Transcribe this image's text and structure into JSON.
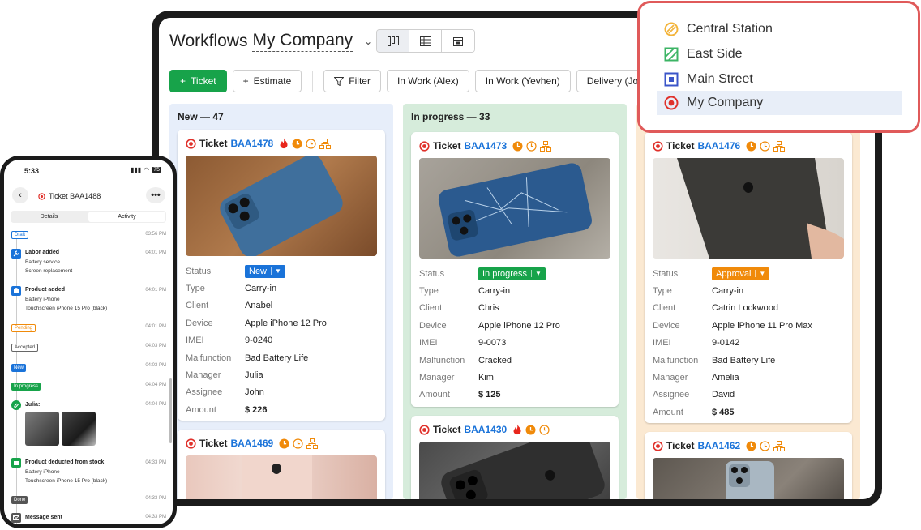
{
  "board": {
    "title": "Workflows",
    "company": "My Company",
    "toolbar": {
      "ticket_label": "Ticket",
      "estimate_label": "Estimate",
      "filter_label": "Filter",
      "filters": [
        "In Work (Alex)",
        "In Work (Yevhen)",
        "Delivery (John"
      ]
    },
    "field_labels": [
      "Status",
      "Type",
      "Client",
      "Device",
      "IMEI",
      "Malfunction",
      "Manager",
      "Assignee",
      "Amount"
    ],
    "columns": [
      {
        "header": "New — 47",
        "bg": "#e7eefa",
        "cards": [
          {
            "title": "Ticket",
            "id": "BAA1478",
            "status": "New",
            "status_color": "#1a73d9",
            "values": [
              "Carry-in",
              "Anabel",
              "Apple iPhone 12 Pro",
              "9-0240",
              "Bad Battery Life",
              "Julia",
              "John",
              "$ 226"
            ]
          },
          {
            "title": "Ticket",
            "id": "BAA1469"
          }
        ]
      },
      {
        "header": "In progress — 33",
        "bg": "#d6ecdb",
        "cards": [
          {
            "title": "Ticket",
            "id": "BAA1473",
            "status": "In progress",
            "status_color": "#17a34a",
            "values": [
              "Carry-in",
              "Chris",
              "Apple iPhone 12 Pro",
              "9-0073",
              "Cracked",
              "Kim",
              "$ 125"
            ]
          },
          {
            "title": "Ticket",
            "id": "BAA1430"
          }
        ]
      },
      {
        "header": "",
        "bg": "#fbe9d2",
        "cards": [
          {
            "title": "Ticket",
            "id": "BAA1476",
            "status": "Approval",
            "status_color": "#f08a0a",
            "values": [
              "Carry-in",
              "Catrin Lockwood",
              "Apple iPhone 11 Pro Max",
              "9-0142",
              "Bad Battery Life",
              "Amelia",
              "David",
              "$ 485"
            ]
          },
          {
            "title": "Ticket",
            "id": "BAA1462"
          }
        ]
      }
    ]
  },
  "locations": [
    {
      "name": "Central Station",
      "color": "#f3b43b",
      "icon": "hatched-circle-icon"
    },
    {
      "name": "East Side",
      "color": "#3cb465",
      "icon": "hatched-square-icon"
    },
    {
      "name": "Main Street",
      "color": "#3b55c8",
      "icon": "square-dot-icon"
    },
    {
      "name": "My Company",
      "color": "#e0312b",
      "icon": "circle-dot-icon",
      "selected": true
    }
  ],
  "phone": {
    "time": "5:33",
    "battery": "75",
    "title": "Ticket BAA1488",
    "tabs": [
      "Details",
      "Activity"
    ],
    "active_tab": "Activity",
    "timeline": {
      "draft": {
        "tag": "Draft",
        "time": "03:56 PM"
      },
      "labor": {
        "title": "Labor added",
        "sub1": "Battery service",
        "sub2": "Screen replacement",
        "time": "04:01 PM"
      },
      "product": {
        "title": "Product added",
        "sub1": "Battery iPhone",
        "sub2": "Touchscreen iPhone 15 Pro (black)",
        "time": "04:01 PM"
      },
      "pending": {
        "tag": "Pending",
        "time": "04:01 PM"
      },
      "accepted": {
        "tag": "Accepted",
        "time": "04:03 PM"
      },
      "new": {
        "tag": "New",
        "time": "04:03 PM"
      },
      "inprogress": {
        "tag": "In progress",
        "time": "04:04 PM"
      },
      "comment": {
        "title": "Julia:",
        "time": "04:04 PM"
      },
      "deducted": {
        "title": "Product deducted from stock",
        "sub1": "Battery iPhone",
        "sub2": "Touchscreen iPhone 15 Pro (black)",
        "time": "04:33 PM"
      },
      "done": {
        "tag": "Done",
        "time": "04:33 PM"
      },
      "message": {
        "title": "Message sent",
        "time": "04:33 PM"
      }
    }
  }
}
